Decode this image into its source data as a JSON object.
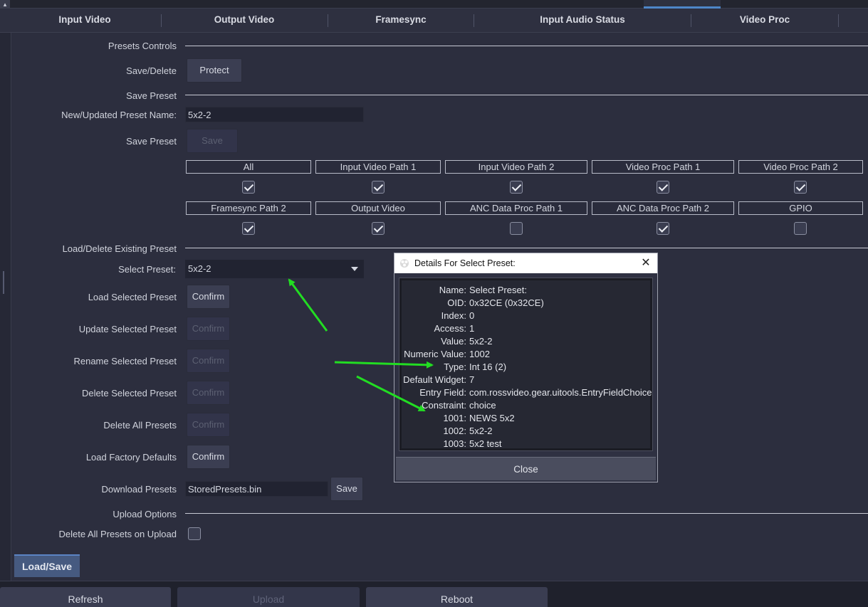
{
  "top_tabs": [
    "Input Video",
    "Output Video",
    "Framesync",
    "Input Audio Status",
    "Video Proc"
  ],
  "presets_controls": {
    "section_label": "Presets Controls",
    "save_delete_label": "Save/Delete",
    "protect_button": "Protect"
  },
  "save_preset": {
    "section_label": "Save Preset",
    "name_label": "New/Updated Preset Name:",
    "name_value": "5x2-2",
    "save_label": "Save Preset",
    "save_button": "Save",
    "paths_row1": [
      {
        "label": "All",
        "checked": true
      },
      {
        "label": "Input Video Path 1",
        "checked": true
      },
      {
        "label": "Input Video Path 2",
        "checked": true
      },
      {
        "label": "Video Proc Path 1",
        "checked": true
      },
      {
        "label": "Video Proc Path 2",
        "checked": true
      }
    ],
    "paths_row2": [
      {
        "label": "Framesync Path 2",
        "checked": true
      },
      {
        "label": "Output Video",
        "checked": true
      },
      {
        "label": "ANC Data Proc Path 1",
        "checked": false
      },
      {
        "label": "ANC Data Proc Path 2",
        "checked": true
      },
      {
        "label": "GPIO",
        "checked": false
      }
    ]
  },
  "load_delete": {
    "section_label": "Load/Delete Existing Preset",
    "select_label": "Select Preset:",
    "select_value": "5x2-2",
    "rows": [
      {
        "label": "Load Selected Preset",
        "button": "Confirm",
        "enabled": true
      },
      {
        "label": "Update Selected Preset",
        "button": "Confirm",
        "enabled": false
      },
      {
        "label": "Rename Selected Preset",
        "button": "Confirm",
        "enabled": false
      },
      {
        "label": "Delete Selected Preset",
        "button": "Confirm",
        "enabled": false
      },
      {
        "label": "Delete All Presets",
        "button": "Confirm",
        "enabled": false
      },
      {
        "label": "Load Factory Defaults",
        "button": "Confirm",
        "enabled": true
      }
    ],
    "download_label": "Download Presets",
    "download_value": "StoredPresets.bin",
    "download_button": "Save"
  },
  "upload_options": {
    "section_label": "Upload Options",
    "delete_all_label": "Delete All Presets on Upload",
    "delete_all_checked": false
  },
  "bottom_tab": "Load/Save",
  "status_buttons": [
    {
      "label": "Refresh",
      "enabled": true
    },
    {
      "label": "Upload",
      "enabled": false
    },
    {
      "label": "Reboot",
      "enabled": true
    }
  ],
  "dialog": {
    "title": "Details For Select Preset:",
    "rows": [
      {
        "key": "Name:",
        "value": "Select Preset:"
      },
      {
        "key": "OID:",
        "value": "0x32CE (0x32CE)"
      },
      {
        "key": "Index:",
        "value": "0"
      },
      {
        "key": "Access:",
        "value": "1"
      },
      {
        "key": "Value:",
        "value": "5x2-2"
      },
      {
        "key": "Numeric Value:",
        "value": "1002"
      },
      {
        "key": "Type:",
        "value": "Int 16 (2)"
      },
      {
        "key": "Default Widget:",
        "value": "7"
      },
      {
        "key": "Entry Field:",
        "value": "com.rossvideo.gear.uitools.EntryFieldChoice"
      },
      {
        "key": "Constraint:",
        "value": "choice"
      },
      {
        "key": "1001:",
        "value": "NEWS 5x2"
      },
      {
        "key": "1002:",
        "value": "5x2-2"
      },
      {
        "key": "1003:",
        "value": "5x2 test"
      }
    ],
    "close_button": "Close"
  },
  "annotation_color": "#22dd22"
}
